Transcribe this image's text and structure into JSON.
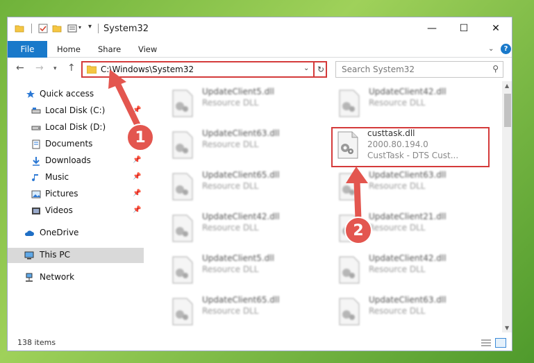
{
  "window": {
    "title": "System32",
    "minimize_glyph": "—",
    "maximize_glyph": "☐",
    "close_glyph": "✕"
  },
  "ribbon": {
    "tabs": [
      "File",
      "Home",
      "Share",
      "View"
    ],
    "collapse_glyph": "⌄",
    "help_label": "?"
  },
  "address": {
    "path": "C:\\Windows\\System32",
    "search_placeholder": "Search System32"
  },
  "nav_pane": {
    "items": [
      {
        "label": "Quick access",
        "icon": "star-icon"
      },
      {
        "label": "Local Disk (C:)",
        "icon": "drive-icon"
      },
      {
        "label": "Local Disk (D:)",
        "icon": "drive-icon"
      },
      {
        "label": "Documents",
        "icon": "documents-icon"
      },
      {
        "label": "Downloads",
        "icon": "download-icon"
      },
      {
        "label": "Music",
        "icon": "music-icon"
      },
      {
        "label": "Pictures",
        "icon": "pictures-icon"
      },
      {
        "label": "Videos",
        "icon": "videos-icon"
      },
      {
        "label": "OneDrive",
        "icon": "cloud-icon"
      },
      {
        "label": "This PC",
        "icon": "computer-icon"
      },
      {
        "label": "Network",
        "icon": "network-icon"
      }
    ]
  },
  "files": [
    {
      "name": "UpdateClient5.dll",
      "desc": "Resource DLL"
    },
    {
      "name": "UpdateClient42.dll",
      "desc": "Resource DLL"
    },
    {
      "name": "UpdateClient63.dll",
      "desc": "Resource DLL"
    },
    {
      "name": "custtask.dll",
      "desc": "2000.80.194.0",
      "desc2": "CustTask - DTS Cust..."
    },
    {
      "name": "UpdateClient65.dll",
      "desc": "Resource DLL"
    },
    {
      "name": "UpdateClient63.dll",
      "desc": "Resource DLL"
    },
    {
      "name": "UpdateClient42.dll",
      "desc": "Resource DLL"
    },
    {
      "name": "UpdateClient21.dll",
      "desc": "Resource DLL"
    },
    {
      "name": "UpdateClient5.dll",
      "desc": "Resource DLL"
    },
    {
      "name": "UpdateClient42.dll",
      "desc": "Resource DLL"
    },
    {
      "name": "UpdateClient65.dll",
      "desc": "Resource DLL"
    },
    {
      "name": "UpdateClient63.dll",
      "desc": "Resource DLL"
    }
  ],
  "status": {
    "item_count": "138 items"
  },
  "annotations": {
    "step1": "1",
    "step2": "2"
  },
  "colors": {
    "accent": "#1979ca",
    "highlight": "#d43a3a",
    "badge": "#e3564f"
  }
}
